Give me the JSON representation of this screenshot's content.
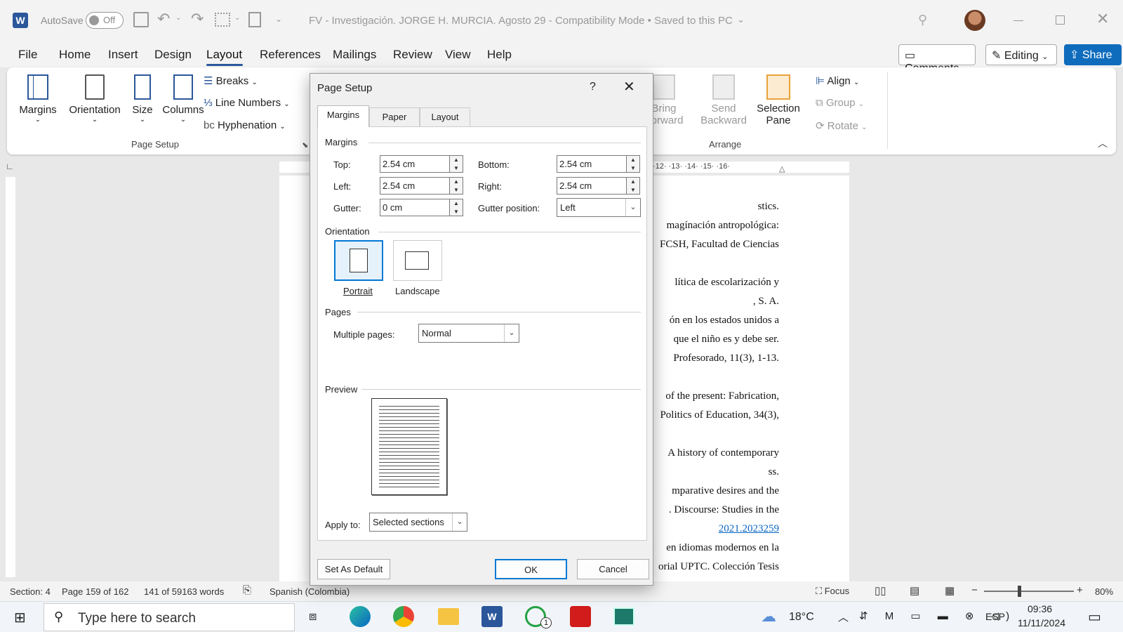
{
  "titlebar": {
    "autosave_label": "AutoSave",
    "autosave_state": "Off",
    "title": "FV - Investigación. JORGE H. MURCIA. Agosto 29  -  Compatibility Mode • Saved to this PC"
  },
  "menu_tabs": [
    "File",
    "Home",
    "Insert",
    "Design",
    "Layout",
    "References",
    "Mailings",
    "Review",
    "View",
    "Help"
  ],
  "active_tab": "Layout",
  "top_right": {
    "comments": "Comments",
    "editing": "Editing",
    "share": "Share"
  },
  "ribbon": {
    "margins": "Margins",
    "orientation": "Orientation",
    "size": "Size",
    "columns": "Columns",
    "breaks": "Breaks",
    "line_numbers": "Line Numbers",
    "hyphenation": "Hyphenation",
    "page_setup_group": "Page Setup",
    "bring_forward_1": "Bring",
    "bring_forward_2": "Forward",
    "send_backward_1": "Send",
    "send_backward_2": "Backward",
    "selection_pane_1": "Selection",
    "selection_pane_2": "Pane",
    "align": "Align",
    "group": "Group",
    "rotate": "Rotate",
    "arrange_group": "Arrange"
  },
  "ruler_numbers": "·12· ·13· ·14· ·15· ·16·",
  "document_lines": [
    "stics.",
    "magínación antropológica:",
    "FCSH, Facultad de Ciencias",
    "lítica de escolarización y",
    ", S. A.",
    "ón en los estados unidos a",
    "que el niño es y debe ser.",
    "Profesorado, 11(3), 1-13.",
    "of the present: Fabrication,",
    "Politics of Education, 34(3),",
    "A history of contemporary",
    "ss.",
    "mparative desires and the",
    ". Discourse: Studies in the",
    "2021.2023259",
    "en idiomas modernos en la",
    "orial UPTC. Colección Tesis"
  ],
  "dialog": {
    "title": "Page Setup",
    "help": "?",
    "tabs": [
      "Margins",
      "Paper",
      "Layout"
    ],
    "active_tab": "Margins",
    "margins_section": "Margins",
    "top_label": "Top:",
    "top_value": "2.54 cm",
    "bottom_label": "Bottom:",
    "bottom_value": "2.54 cm",
    "left_label": "Left:",
    "left_value": "2.54 cm",
    "right_label": "Right:",
    "right_value": "2.54 cm",
    "gutter_label": "Gutter:",
    "gutter_value": "0 cm",
    "gutter_position_label": "Gutter position:",
    "gutter_position_value": "Left",
    "orientation_section": "Orientation",
    "portrait": "Portrait",
    "landscape": "Landscape",
    "selected_orientation": "Portrait",
    "pages_section": "Pages",
    "multiple_pages_label": "Multiple pages:",
    "multiple_pages_value": "Normal",
    "preview_section": "Preview",
    "apply_to_label": "Apply to:",
    "apply_to_value": "Selected sections",
    "set_as_default": "Set As Default",
    "ok": "OK",
    "cancel": "Cancel"
  },
  "status": {
    "section": "Section: 4",
    "page": "Page 159 of 162",
    "words": "141 of 59163 words",
    "language": "Spanish (Colombia)",
    "focus": "Focus",
    "zoom": "80%"
  },
  "taskbar": {
    "search_placeholder": "Type here to search",
    "temperature": "18°C",
    "lang": "ESP",
    "time": "09:36",
    "date": "11/11/2024",
    "whatsapp_badge": "1"
  },
  "colors": {
    "word_blue": "#2b579a",
    "share_blue": "#0f6cbd",
    "accent": "#0078d4"
  }
}
